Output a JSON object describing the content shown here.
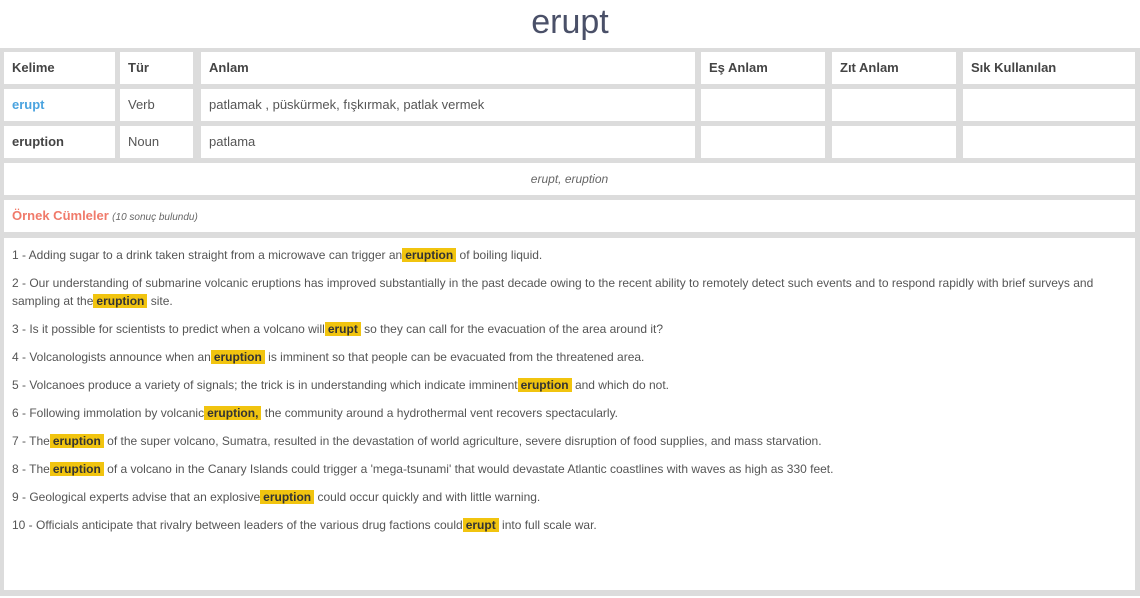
{
  "page": {
    "title": "erupt"
  },
  "table": {
    "headers": [
      "Kelime",
      "Tür",
      "Anlam",
      "Eş Anlam",
      "Zıt Anlam",
      "Sık Kullanılan"
    ],
    "rows": [
      {
        "word": "erupt",
        "type": "Verb",
        "meaning": "patlamak , püskürmek, fışkırmak, patlak vermek",
        "synonym": "",
        "antonym": "",
        "common": ""
      },
      {
        "word": "eruption",
        "type": "Noun",
        "meaning": "patlama",
        "synonym": "",
        "antonym": "",
        "common": ""
      }
    ]
  },
  "related_words": "erupt, eruption",
  "examples": {
    "label": "Örnek Cümleler",
    "count_text": "(10 sonuç bulundu)",
    "highlight_color": "#f1c40f",
    "sentences": [
      {
        "before": "1 - Adding sugar to a drink taken straight from a microwave can trigger an",
        "hl": "eruption",
        "after": "of boiling liquid."
      },
      {
        "before": "2 - Our understanding of submarine volcanic eruptions has improved substantially in the past decade owing to the recent ability to remotely detect such events and to respond rapidly with brief surveys and sampling at the",
        "hl": "eruption",
        "after": "site."
      },
      {
        "before": "3 - Is it possible for scientists to predict when a volcano will",
        "hl": "erupt",
        "after": "so they can call for the evacuation of the area around it?"
      },
      {
        "before": "4 - Volcanologists announce when an",
        "hl": "eruption",
        "after": "is imminent so that people can be evacuated from the threatened area."
      },
      {
        "before": "5 - Volcanoes produce a variety of signals; the trick is in understanding which indicate imminent",
        "hl": "eruption",
        "after": "and which do not."
      },
      {
        "before": "6 - Following immolation by volcanic",
        "hl": "eruption,",
        "after": "the community around a hydrothermal vent recovers spectacularly."
      },
      {
        "before": "7 - The",
        "hl": "eruption",
        "after": "of the super volcano, Sumatra, resulted in the devastation of world agriculture, severe disruption of food supplies, and mass starvation."
      },
      {
        "before": "8 - The",
        "hl": "eruption",
        "after": "of a volcano in the Canary Islands could trigger a 'mega-tsunami' that would devastate Atlantic coastlines with waves as high as 330 feet."
      },
      {
        "before": "9 - Geological experts advise that an explosive",
        "hl": "eruption",
        "after": "could occur quickly and with little warning."
      },
      {
        "before": "10 - Officials anticipate that rivalry between leaders of the various drug factions could",
        "hl": "erupt",
        "after": "into full scale war."
      }
    ]
  }
}
